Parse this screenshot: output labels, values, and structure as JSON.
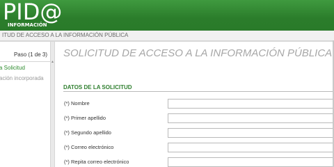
{
  "header": {
    "logo_main": "PID@",
    "logo_sub": "INFORMACIÓN"
  },
  "breadcrumb": "ITUD DE ACCESO A LA INFORMACIÓN PÚBLICA",
  "sidebar": {
    "step": "Paso (1 de 3)",
    "items": [
      {
        "label": "a Solicitud",
        "state": "active"
      },
      {
        "label": "ación incorporada",
        "state": "done"
      }
    ]
  },
  "main": {
    "title": "SOLICITUD DE ACCESO A LA INFORMACIÓN PÚBLICA - S",
    "section_title": "DATOS DE LA SOLICITUD",
    "fields": [
      {
        "label": "(*) Nombre",
        "value": ""
      },
      {
        "label": "(*) Primer apellido",
        "value": ""
      },
      {
        "label": "(*) Segundo apellido",
        "value": ""
      },
      {
        "label": "(*) Correo electrónico",
        "value": ""
      },
      {
        "label": "(*) Repita correo electrónico",
        "value": ""
      }
    ]
  },
  "colors": {
    "brand_green": "#2b7d2b",
    "accent_green": "#2e8b2e"
  }
}
